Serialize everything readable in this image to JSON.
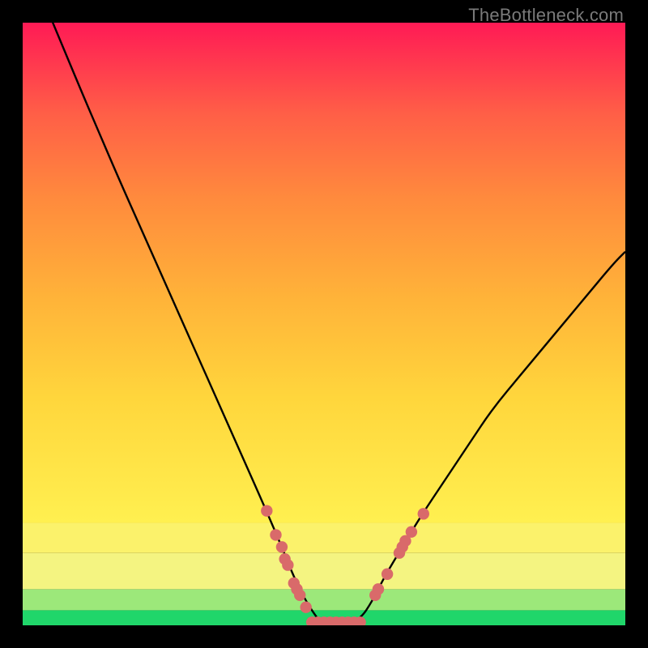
{
  "watermark": "TheBottleneck.com",
  "chart_data": {
    "type": "line",
    "title": "",
    "xlabel": "",
    "ylabel": "",
    "xlim": [
      0,
      100
    ],
    "ylim": [
      0,
      100
    ],
    "background_bands": [
      {
        "y0": 0,
        "y1": 2.5,
        "color": "#20d66a"
      },
      {
        "y0": 2.5,
        "y1": 6,
        "color": "#9ce87a"
      },
      {
        "y0": 6,
        "y1": 12,
        "color": "#f4f481"
      },
      {
        "y0": 12,
        "y1": 17,
        "color": "#fbf26b"
      }
    ],
    "background_gradient": {
      "from_y": 17,
      "to_y": 100,
      "stops": [
        {
          "pos": 0.0,
          "color": "#fff050"
        },
        {
          "pos": 0.25,
          "color": "#ffd63c"
        },
        {
          "pos": 0.45,
          "color": "#ffb339"
        },
        {
          "pos": 0.65,
          "color": "#ff8a3d"
        },
        {
          "pos": 0.82,
          "color": "#ff5e47"
        },
        {
          "pos": 1.0,
          "color": "#ff1a55"
        }
      ]
    },
    "series": [
      {
        "name": "curve",
        "x": [
          0,
          5,
          10,
          13,
          16,
          20,
          24,
          28,
          32,
          36,
          40,
          43,
          45,
          47,
          49,
          50,
          53,
          56,
          58,
          60,
          63,
          66,
          70,
          74,
          78,
          83,
          88,
          93,
          98,
          100
        ],
        "y": [
          112,
          100,
          88,
          81,
          74,
          65,
          56,
          47,
          38,
          29,
          20,
          13,
          8,
          4,
          1,
          0,
          0,
          1,
          4,
          8,
          13,
          18,
          24,
          30,
          36,
          42,
          48,
          54,
          60,
          62
        ]
      }
    ],
    "markers": {
      "color": "#d96a6a",
      "points": [
        {
          "x": 40.5,
          "y": 19
        },
        {
          "x": 42.0,
          "y": 15
        },
        {
          "x": 43.0,
          "y": 13
        },
        {
          "x": 43.5,
          "y": 11
        },
        {
          "x": 44.0,
          "y": 10
        },
        {
          "x": 45.0,
          "y": 7
        },
        {
          "x": 45.5,
          "y": 6
        },
        {
          "x": 46.0,
          "y": 5
        },
        {
          "x": 47.0,
          "y": 3
        },
        {
          "x": 48.0,
          "y": 0.5
        },
        {
          "x": 49.0,
          "y": 0.5
        },
        {
          "x": 50.0,
          "y": 0.5
        },
        {
          "x": 51.0,
          "y": 0.5
        },
        {
          "x": 52.0,
          "y": 0.5
        },
        {
          "x": 53.0,
          "y": 0.5
        },
        {
          "x": 54.0,
          "y": 0.5
        },
        {
          "x": 55.0,
          "y": 0.5
        },
        {
          "x": 56.0,
          "y": 0.5
        },
        {
          "x": 58.5,
          "y": 5
        },
        {
          "x": 59.0,
          "y": 6
        },
        {
          "x": 60.5,
          "y": 8.5
        },
        {
          "x": 62.5,
          "y": 12
        },
        {
          "x": 63.0,
          "y": 13
        },
        {
          "x": 63.5,
          "y": 14
        },
        {
          "x": 64.5,
          "y": 15.5
        },
        {
          "x": 66.5,
          "y": 18.5
        }
      ]
    }
  }
}
